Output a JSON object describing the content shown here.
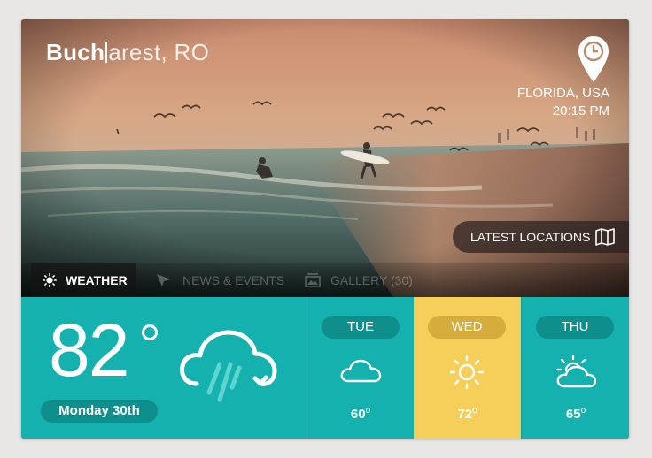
{
  "header": {
    "city_bold": "Buch",
    "city_rest": "arest, RO"
  },
  "location": {
    "name": "FLORIDA, USA",
    "time": "20:15 PM",
    "pin_icon": "location-clock-pin-icon"
  },
  "latest_locations": {
    "label": "LATEST LOCATIONS",
    "icon": "map-icon"
  },
  "tabs": [
    {
      "label": "WEATHER",
      "icon": "sun-icon",
      "active": true
    },
    {
      "label": "NEWS & EVENTS",
      "icon": "send-icon",
      "active": false
    },
    {
      "label": "GALLERY (30)",
      "icon": "gallery-icon",
      "active": false
    }
  ],
  "current": {
    "temp": "82",
    "date": "Monday 30th",
    "icon": "rain-cloud-icon"
  },
  "forecast": [
    {
      "day": "TUE",
      "temp": "60",
      "icon": "cloud-icon"
    },
    {
      "day": "WED",
      "temp": "72",
      "icon": "sun-icon",
      "highlighted": true
    },
    {
      "day": "THU",
      "temp": "65",
      "icon": "partly-cloudy-icon"
    }
  ],
  "colors": {
    "teal": "#14b1ae",
    "teal_dark": "#0f8f8c",
    "yellow": "#f6cf5a",
    "yellow_dark": "#d6ac3c"
  }
}
